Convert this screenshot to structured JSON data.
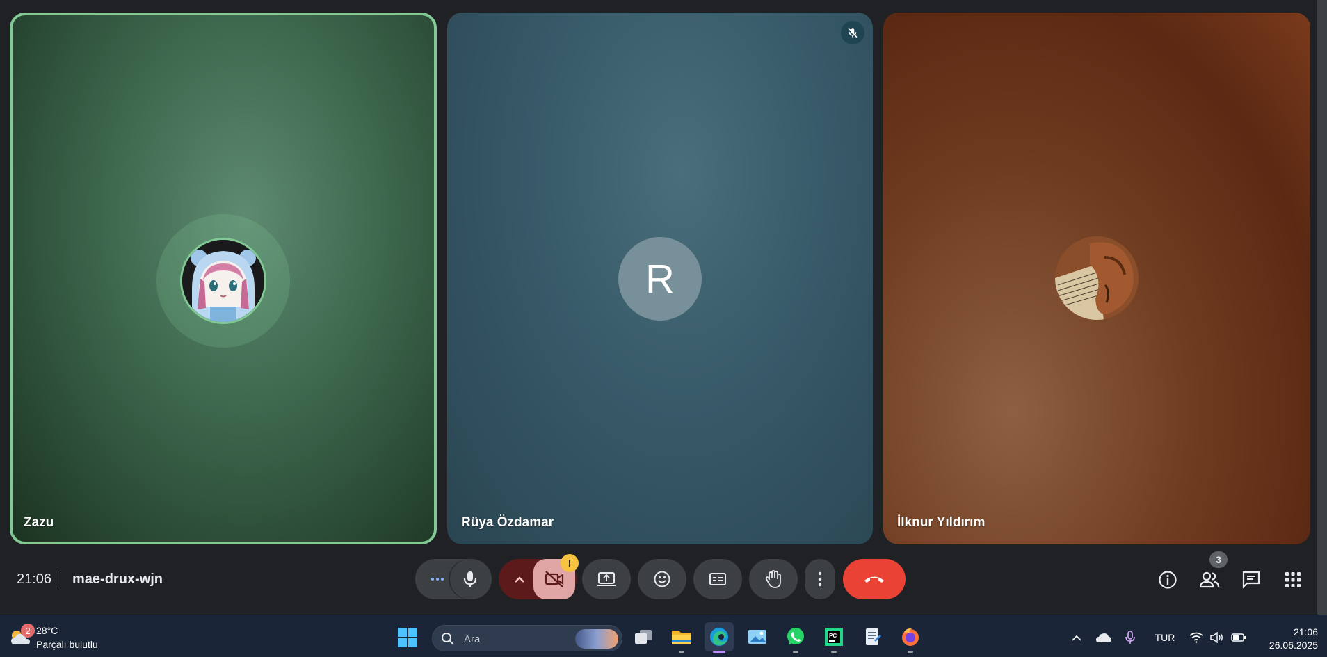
{
  "tiles": [
    {
      "name": "Zazu",
      "avatar": "anime-girl-avatar",
      "speaking": true
    },
    {
      "name": "Rüya Özdamar",
      "avatar_letter": "R",
      "muted": true
    },
    {
      "name": "İlknur Yıldırım",
      "avatar": "violin-sheet-music-avatar"
    }
  ],
  "bottom_bar": {
    "time": "21:06",
    "meeting_code": "mae-drux-wjn",
    "camera_warning": "!",
    "people_count": "3"
  },
  "colors": {
    "speaking_border": "#81c995",
    "leave_button": "#ea4335",
    "camera_off_bg": "#e0a5a5",
    "warning": "#f6c341"
  },
  "taskbar": {
    "weather": {
      "badge": "2",
      "temperature": "28°C",
      "condition": "Parçalı bulutlu"
    },
    "search_placeholder": "Ara",
    "language": "TUR",
    "clock_time": "21:06",
    "clock_date": "26.06.2025"
  }
}
